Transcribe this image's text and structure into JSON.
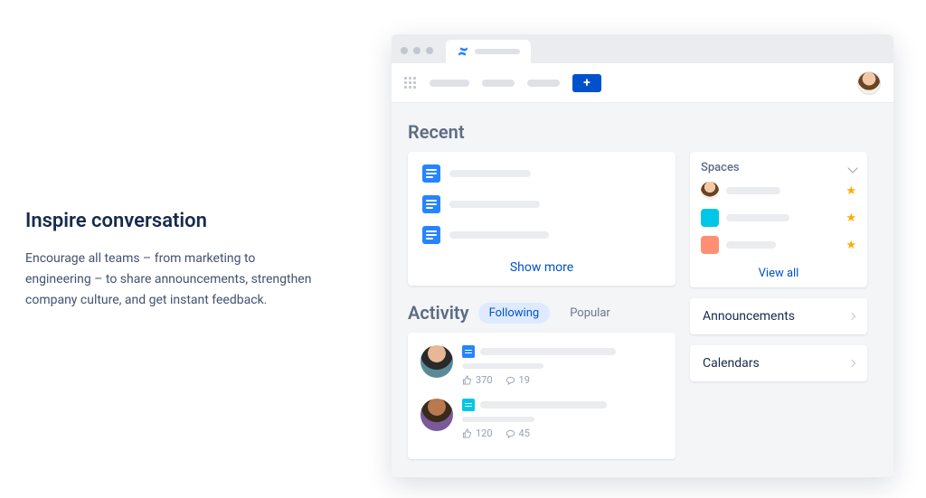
{
  "landing": {
    "heading": "Inspire conversation",
    "paragraph": "Encourage all teams – from marketing to engineering – to share announcements, strengthen company culture, and get instant feedback."
  },
  "toolbar": {
    "add_label": "+"
  },
  "sections": {
    "recent_title": "Recent",
    "show_more": "Show more",
    "activity_title": "Activity"
  },
  "activity_tabs": {
    "following": "Following",
    "popular": "Popular"
  },
  "activity_items": [
    {
      "likes": "370",
      "comments": "19"
    },
    {
      "likes": "120",
      "comments": "45"
    }
  ],
  "spaces": {
    "title": "Spaces",
    "view_all": "View all"
  },
  "side_links": {
    "announcements": "Announcements",
    "calendars": "Calendars"
  }
}
